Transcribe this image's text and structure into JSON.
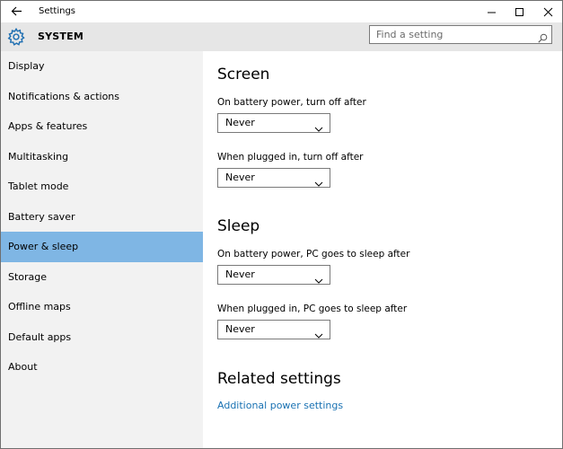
{
  "window": {
    "title": "Settings",
    "back_icon": "back-arrow-icon",
    "controls": [
      "minimize-icon",
      "maximize-icon",
      "close-icon"
    ]
  },
  "header": {
    "icon": "gear-icon",
    "title": "SYSTEM",
    "search": {
      "placeholder": "Find a setting",
      "value": "",
      "icon": "search-icon"
    }
  },
  "sidebar": {
    "items": [
      {
        "label": "Display"
      },
      {
        "label": "Notifications & actions"
      },
      {
        "label": "Apps & features"
      },
      {
        "label": "Multitasking"
      },
      {
        "label": "Tablet mode"
      },
      {
        "label": "Battery saver"
      },
      {
        "label": "Power & sleep",
        "selected": true
      },
      {
        "label": "Storage"
      },
      {
        "label": "Offline maps"
      },
      {
        "label": "Default apps"
      },
      {
        "label": "About"
      }
    ],
    "selected_color": "#7fb6e4",
    "background_color": "#f2f2f2"
  },
  "main": {
    "screen": {
      "title": "Screen",
      "battery": {
        "label": "On battery power, turn off after",
        "value": "Never"
      },
      "plugged": {
        "label": "When plugged in, turn off after",
        "value": "Never"
      }
    },
    "sleep": {
      "title": "Sleep",
      "battery": {
        "label": "On battery power, PC goes to sleep after",
        "value": "Never"
      },
      "plugged": {
        "label": "When plugged in, PC goes to sleep after",
        "value": "Never"
      }
    },
    "related": {
      "title": "Related settings",
      "link": "Additional power settings",
      "link_color": "#1a72b3"
    }
  }
}
